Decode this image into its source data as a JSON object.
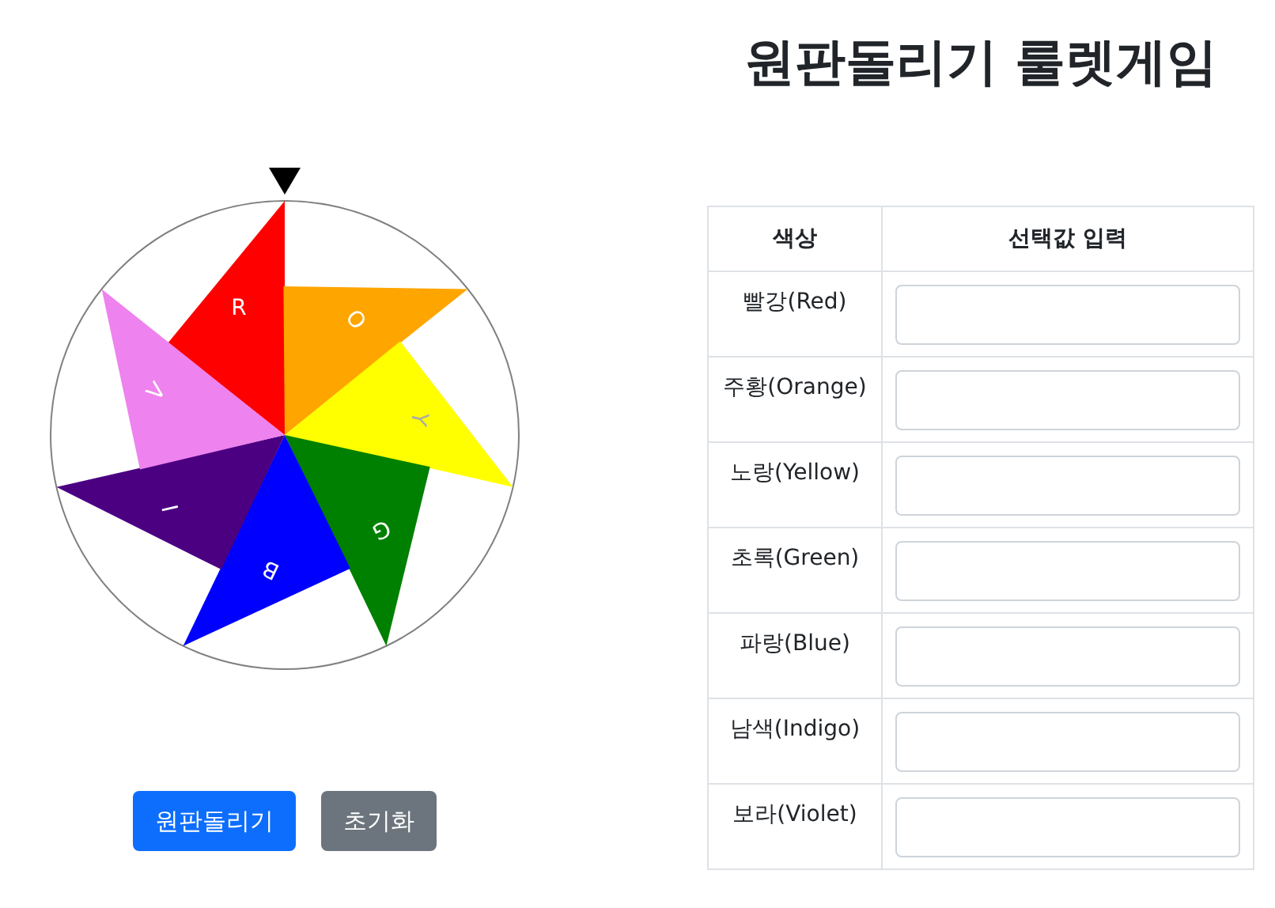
{
  "title": "원판돌리기 룰렛게임",
  "wheel": {
    "segments": [
      {
        "label": "R",
        "color": "#ff0000"
      },
      {
        "label": "O",
        "color": "#ffa500"
      },
      {
        "label": "Y",
        "color": "#ffff00"
      },
      {
        "label": "G",
        "color": "#008000"
      },
      {
        "label": "B",
        "color": "#0000ff"
      },
      {
        "label": "I",
        "color": "#4b0082"
      },
      {
        "label": "V",
        "color": "#ee82ee"
      }
    ]
  },
  "buttons": [
    {
      "label": "원판돌리기",
      "kind": "primary"
    },
    {
      "label": "초기화",
      "kind": "secondary"
    }
  ],
  "table": {
    "columns": [
      "색상",
      "선택값 입력"
    ],
    "rows": [
      {
        "color_name": "빨강(Red)"
      },
      {
        "color_name": "주황(Orange)"
      },
      {
        "color_name": "노랑(Yellow)"
      },
      {
        "color_name": "초록(Green)"
      },
      {
        "color_name": "파랑(Blue)"
      },
      {
        "color_name": "남색(Indigo)"
      },
      {
        "color_name": "보라(Violet)"
      }
    ]
  }
}
